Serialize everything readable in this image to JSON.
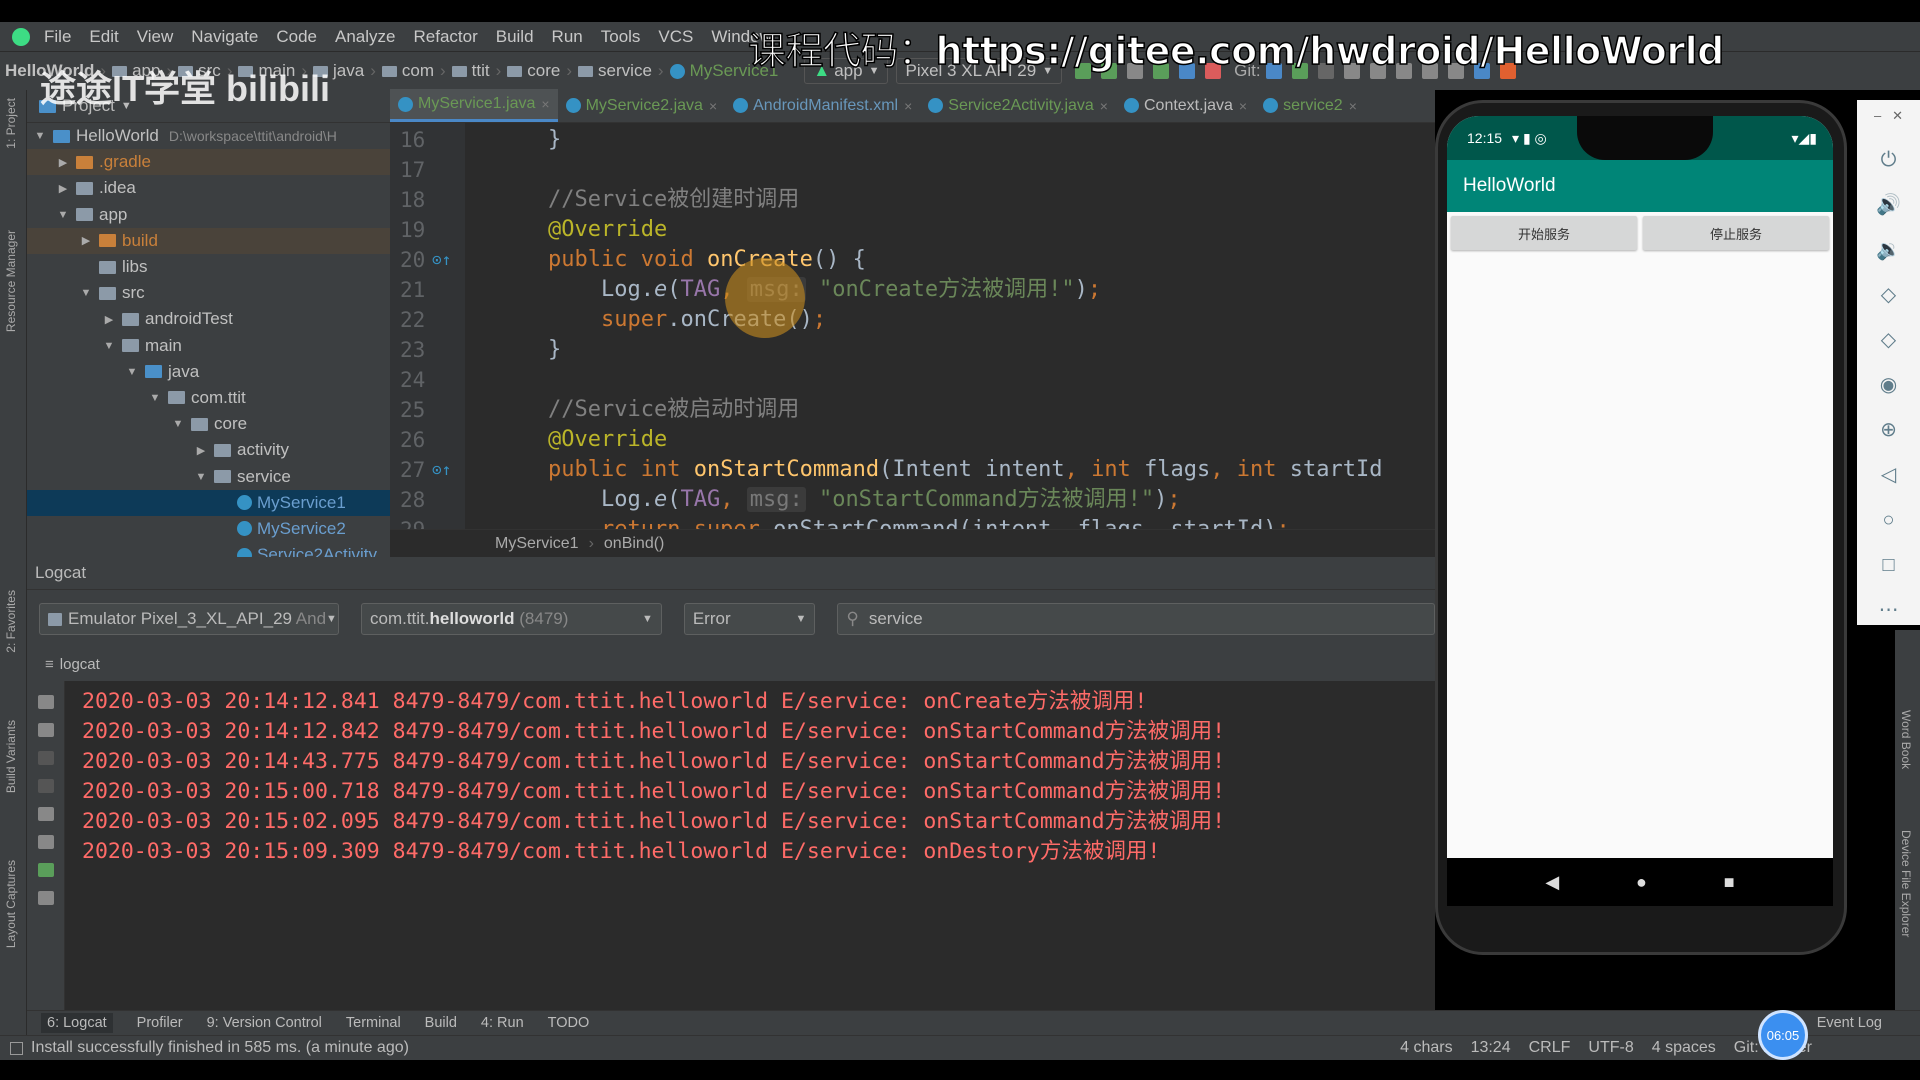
{
  "menu": [
    "File",
    "Edit",
    "View",
    "Navigate",
    "Code",
    "Analyze",
    "Refactor",
    "Build",
    "Run",
    "Tools",
    "VCS",
    "Window"
  ],
  "breadcrumb": [
    "HelloWorld",
    "app",
    "src",
    "main",
    "java",
    "com",
    "ttit",
    "core",
    "service",
    "MyService1"
  ],
  "toolbar": {
    "run_config": "app",
    "device": "Pixel 3 XL API 29",
    "git_label": "Git:"
  },
  "overlay": {
    "prefix": "课程代码：",
    "url": "https://gitee.com/hwdroid/HelloWorld",
    "watermark": "途途IT学堂 bilibili"
  },
  "project": {
    "header": "Project",
    "tree": [
      {
        "label": "HelloWorld",
        "path": "D:\\workspace\\ttit\\android\\H",
        "level": 0,
        "open": true,
        "icon": "blue"
      },
      {
        "label": ".gradle",
        "level": 1,
        "open": false,
        "icon": "orange",
        "excluded": true
      },
      {
        "label": ".idea",
        "level": 1,
        "open": false
      },
      {
        "label": "app",
        "level": 1,
        "open": true
      },
      {
        "label": "build",
        "level": 2,
        "open": false,
        "icon": "orange",
        "excluded": true
      },
      {
        "label": "libs",
        "level": 2
      },
      {
        "label": "src",
        "level": 2,
        "open": true
      },
      {
        "label": "androidTest",
        "level": 3,
        "open": false
      },
      {
        "label": "main",
        "level": 3,
        "open": true
      },
      {
        "label": "java",
        "level": 4,
        "open": true,
        "icon": "blue"
      },
      {
        "label": "com.ttit",
        "level": 5,
        "open": true
      },
      {
        "label": "core",
        "level": 6,
        "open": true
      },
      {
        "label": "activity",
        "level": 7,
        "open": false
      },
      {
        "label": "service",
        "level": 7,
        "open": true
      },
      {
        "label": "MyService1",
        "level": 8,
        "cls": true,
        "selected": true
      },
      {
        "label": "MyService2",
        "level": 8,
        "cls": true
      },
      {
        "label": "Service2Activity",
        "level": 8,
        "cls": true
      }
    ]
  },
  "tabs": [
    {
      "label": "MyService1.java",
      "active": true,
      "color": "#6a9955"
    },
    {
      "label": "MyService2.java",
      "color": "#6a9955"
    },
    {
      "label": "AndroidManifest.xml",
      "color": "#6897bb"
    },
    {
      "label": "Service2Activity.java",
      "color": "#6a9955"
    },
    {
      "label": "Context.java",
      "color": "#bbbbbb"
    },
    {
      "label": "service2",
      "color": "#6a9955"
    }
  ],
  "code": [
    {
      "n": "16",
      "t": [
        [
          "pl",
          "}"
        ]
      ]
    },
    {
      "n": "17",
      "t": []
    },
    {
      "n": "18",
      "t": [
        [
          "cmt",
          "//Service被创建时调用"
        ]
      ]
    },
    {
      "n": "19",
      "t": [
        [
          "ann",
          "@Override"
        ]
      ]
    },
    {
      "n": "20",
      "mark": true,
      "t": [
        [
          "kw",
          "public void "
        ],
        [
          "fn",
          "onCreate"
        ],
        [
          "pl",
          "() {"
        ]
      ]
    },
    {
      "n": "21",
      "t": [
        [
          "pl",
          "    Log."
        ],
        [
          "it",
          "e"
        ],
        [
          "pl",
          "("
        ],
        [
          "fld",
          "TAG"
        ],
        [
          "kw",
          ", "
        ],
        [
          "hint",
          "msg:"
        ],
        [
          "str",
          " \"onCreate方法被调用!\""
        ],
        [
          "pl",
          ")"
        ],
        [
          "kw",
          ";"
        ]
      ]
    },
    {
      "n": "22",
      "t": [
        [
          "kw",
          "    super"
        ],
        [
          "pl",
          ".onCreate()"
        ],
        [
          "kw",
          ";"
        ]
      ]
    },
    {
      "n": "23",
      "t": [
        [
          "pl",
          "}"
        ]
      ]
    },
    {
      "n": "24",
      "t": []
    },
    {
      "n": "25",
      "t": [
        [
          "cmt",
          "//Service被启动时调用"
        ]
      ]
    },
    {
      "n": "26",
      "t": [
        [
          "ann",
          "@Override"
        ]
      ]
    },
    {
      "n": "27",
      "mark": true,
      "t": [
        [
          "kw",
          "public int "
        ],
        [
          "fn",
          "onStartCommand"
        ],
        [
          "pl",
          "(Intent intent"
        ],
        [
          "kw",
          ", int "
        ],
        [
          "pl",
          "flags"
        ],
        [
          "kw",
          ", int "
        ],
        [
          "pl",
          "startId"
        ]
      ]
    },
    {
      "n": "28",
      "t": [
        [
          "pl",
          "    Log."
        ],
        [
          "it",
          "e"
        ],
        [
          "pl",
          "("
        ],
        [
          "fld",
          "TAG"
        ],
        [
          "kw",
          ", "
        ],
        [
          "hint",
          "msg:"
        ],
        [
          "str",
          " \"onStartCommand方法被调用!\""
        ],
        [
          "pl",
          ")"
        ],
        [
          "kw",
          ";"
        ]
      ]
    },
    {
      "n": "29",
      "t": [
        [
          "kw",
          "    return super"
        ],
        [
          "pl",
          ".onStartCommand(intent, flags, startId)"
        ],
        [
          "kw",
          ";"
        ]
      ]
    }
  ],
  "editor_breadcrumb": [
    "MyService1",
    "onBind()"
  ],
  "logcat": {
    "title": "Logcat",
    "device": "Emulator Pixel_3_XL_API_29",
    "device_suffix": "And",
    "process_pkg": "com.ttit.",
    "process_bold": "helloworld",
    "process_pid": "(8479)",
    "level": "Error",
    "search": "service",
    "tab": "logcat",
    "lines": [
      "2020-03-03 20:14:12.841 8479-8479/com.ttit.helloworld E/service: onCreate方法被调用!",
      "2020-03-03 20:14:12.842 8479-8479/com.ttit.helloworld E/service: onStartCommand方法被调用!",
      "2020-03-03 20:14:43.775 8479-8479/com.ttit.helloworld E/service: onStartCommand方法被调用!",
      "2020-03-03 20:15:00.718 8479-8479/com.ttit.helloworld E/service: onStartCommand方法被调用!",
      "2020-03-03 20:15:02.095 8479-8479/com.ttit.helloworld E/service: onStartCommand方法被调用!",
      "2020-03-03 20:15:09.309 8479-8479/com.ttit.helloworld E/service: onDestory方法被调用!"
    ]
  },
  "toolwindows": [
    "6: Logcat",
    "Profiler",
    "9: Version Control",
    "Terminal",
    "Build",
    "4: Run",
    "TODO"
  ],
  "event_log": "Event Log",
  "status": {
    "message": "Install successfully finished in 585 ms. (a minute ago)",
    "chars": "4 chars",
    "position": "13:24",
    "line_sep": "CRLF",
    "encoding": "UTF-8",
    "indent": "4 spaces",
    "git": "Git: master"
  },
  "timer": "06:05",
  "phone": {
    "time": "12:15",
    "app_title": "HelloWorld",
    "start_button": "开始服务",
    "stop_button": "停止服务"
  },
  "side_labels": {
    "project": "1: Project",
    "resource": "Resource Manager",
    "favorites": "2: Favorites",
    "build_variants": "Build Variants",
    "layout": "Layout Captures",
    "word_book": "Word Book",
    "device_explorer": "Device File Explorer"
  },
  "colors": {
    "log_error": "#ff6b68",
    "app_bar": "#008577",
    "selection": "#0d3a58"
  }
}
